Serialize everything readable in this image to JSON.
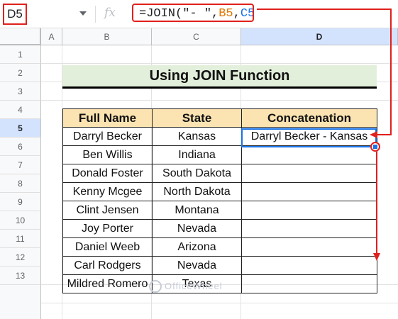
{
  "formula_bar": {
    "name_box": "D5",
    "fx": "fx",
    "formula_prefix": "=JOIN(\"- \",",
    "ref_b": "B5",
    "comma": ",",
    "ref_c": "C5",
    "formula_suffix": ")"
  },
  "columns": [
    "A",
    "B",
    "C",
    "D"
  ],
  "selected_column": "D",
  "rows": [
    "1",
    "2",
    "3",
    "4",
    "5",
    "6",
    "7",
    "8",
    "9",
    "10",
    "11",
    "12",
    "13"
  ],
  "selected_row": "5",
  "title": "Using JOIN Function",
  "table": {
    "headers": [
      "Full Name",
      "State",
      "Concatenation"
    ],
    "rows": [
      [
        "Darryl Becker",
        "Kansas",
        "Darryl Becker - Kansas"
      ],
      [
        "Ben  Willis",
        "Indiana",
        ""
      ],
      [
        "Donald  Foster",
        "South Dakota",
        ""
      ],
      [
        "Kenny Mcgee",
        "North Dakota",
        ""
      ],
      [
        "Clint  Jensen",
        "Montana",
        ""
      ],
      [
        "Joy  Porter",
        "Nevada",
        ""
      ],
      [
        "Daniel  Weeb",
        "Arizona",
        ""
      ],
      [
        "Carl  Rodgers",
        "Nevada",
        ""
      ],
      [
        "Mildred  Romero",
        "Texas",
        ""
      ]
    ]
  },
  "watermark": "OfficeWheel",
  "colors": {
    "highlight": "#e0201c",
    "selection": "#1a73e8",
    "title_bg": "#e2efda",
    "header_bg": "#fce4b2"
  }
}
